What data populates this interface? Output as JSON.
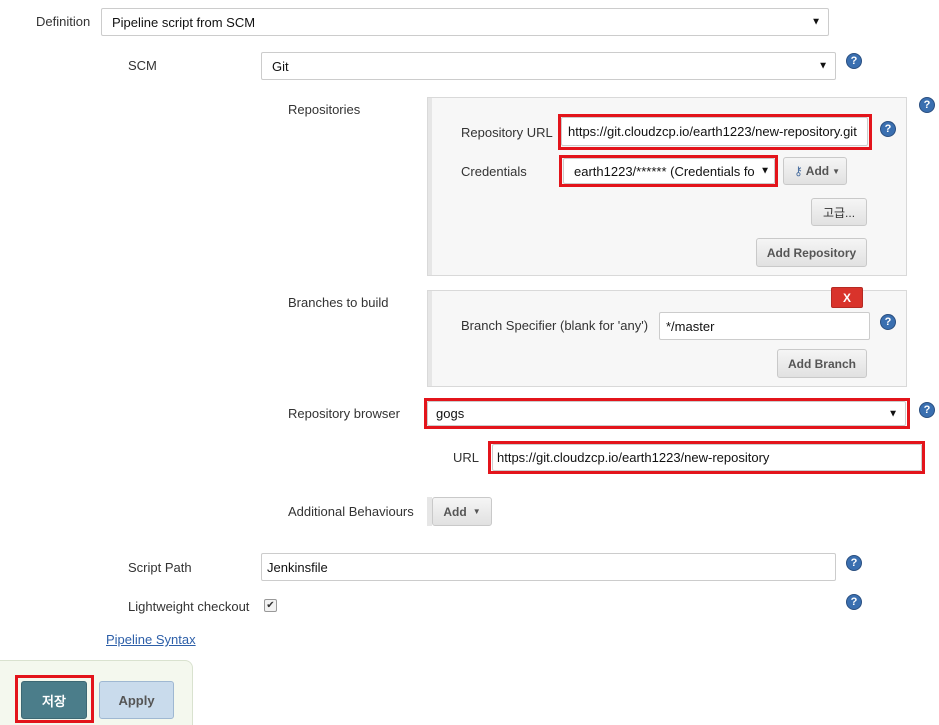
{
  "definition": {
    "label": "Definition",
    "value": "Pipeline script from SCM"
  },
  "scm": {
    "label": "SCM",
    "value": "Git"
  },
  "repositories": {
    "label": "Repositories",
    "repository_url_label": "Repository URL",
    "repository_url_value": "https://git.cloudzcp.io/earth1223/new-repository.git",
    "credentials_label": "Credentials",
    "credentials_value": "earth1223/****** (Credentials fo",
    "add_credentials_label": "Add",
    "advanced_label": "고급...",
    "add_repository_label": "Add Repository"
  },
  "branches": {
    "label": "Branches to build",
    "delete_label": "X",
    "specifier_label": "Branch Specifier (blank for 'any')",
    "specifier_value": "*/master",
    "add_branch_label": "Add Branch"
  },
  "repository_browser": {
    "label": "Repository browser",
    "value": "gogs",
    "url_label": "URL",
    "url_value": "https://git.cloudzcp.io/earth1223/new-repository"
  },
  "additional_behaviours": {
    "label": "Additional Behaviours",
    "add_label": "Add"
  },
  "script_path": {
    "label": "Script Path",
    "value": "Jenkinsfile"
  },
  "lightweight_checkout": {
    "label": "Lightweight checkout",
    "checked": true
  },
  "pipeline_syntax_link": "Pipeline Syntax",
  "footer": {
    "save_label": "저장",
    "apply_label": "Apply"
  },
  "colors": {
    "highlight": "#e3141b",
    "save_button": "#4b7d8a",
    "apply_button": "#c9dbec",
    "help_icon": "#3a6fb0",
    "delete_button": "#d9332b"
  }
}
